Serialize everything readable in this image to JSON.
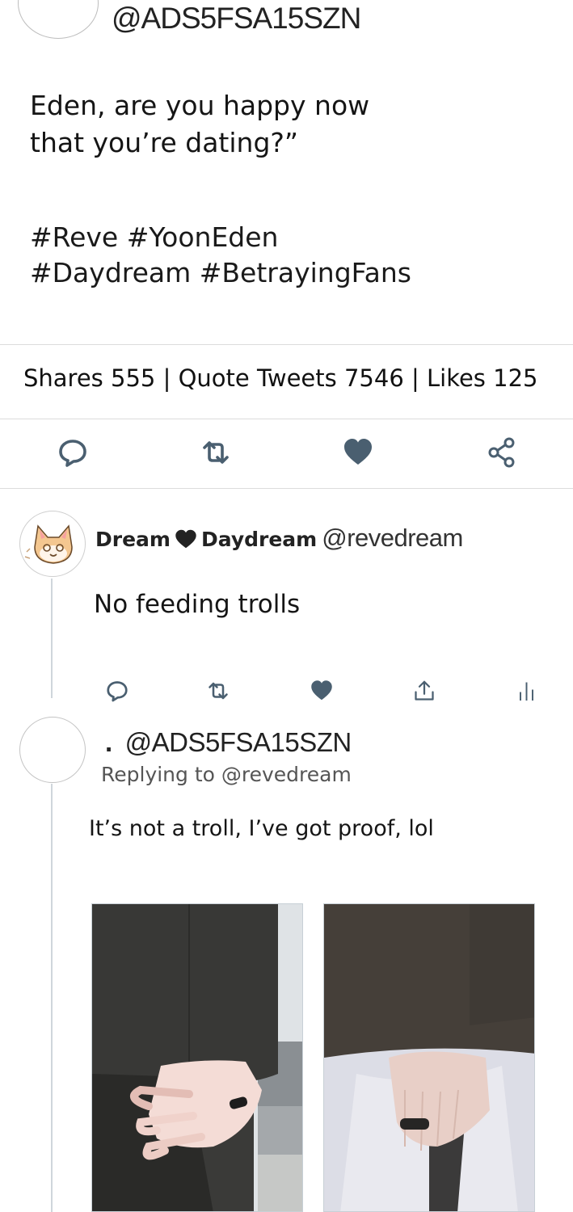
{
  "tweet": {
    "handle": "@ADS5FSA15SZN",
    "text_line1": "Eden, are you happy now",
    "text_line2": "that you’re dating?”",
    "tags_line1": "#Reve #YoonEden",
    "tags_line2": "#Daydream #BetrayingFans",
    "stats": "Shares 555 | Quote Tweets 7546 | Likes 125"
  },
  "actions": [
    "reply-icon",
    "retweet-icon",
    "heart-icon",
    "share-icon"
  ],
  "reply1": {
    "name_part1": "Dream",
    "name_part2": "Daydream",
    "handle": "@revedream",
    "text": "No feeding trolls"
  },
  "reply2": {
    "dot": ".",
    "handle": "@ADS5FSA15SZN",
    "replying": "Replying to @revedream",
    "text": "It’s not a troll, I’ve got proof, lol"
  },
  "colors": {
    "icon": "#4a5f70",
    "divider": "#dcdcdc",
    "thread_line": "#cfd6db"
  }
}
